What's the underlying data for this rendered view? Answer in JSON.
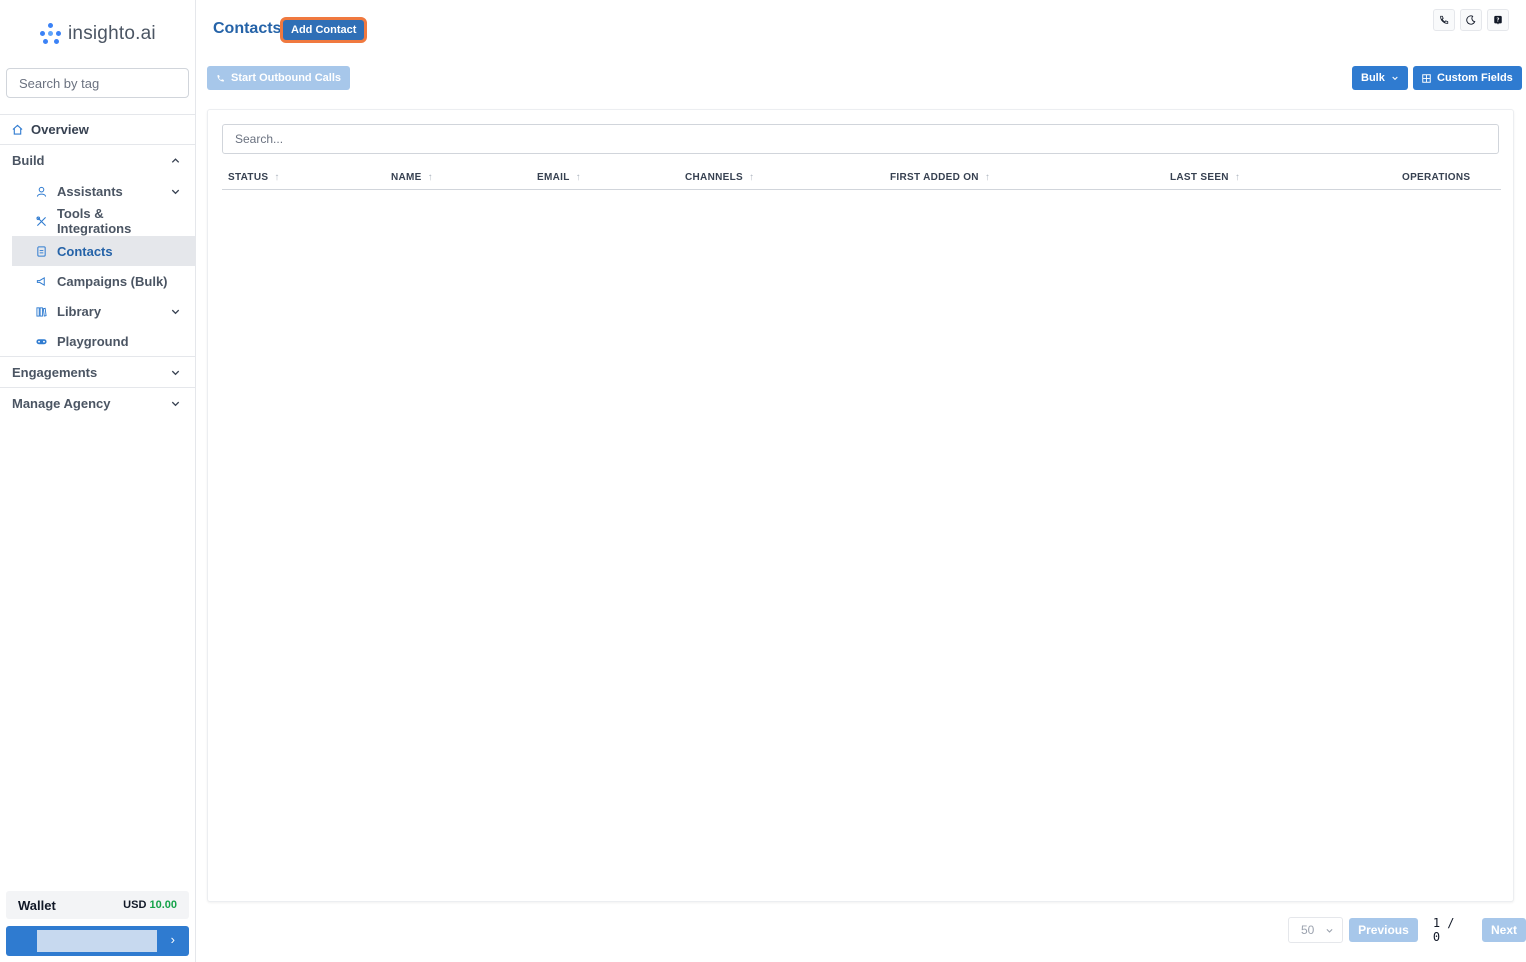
{
  "brand": {
    "name": "insighto.ai"
  },
  "sidebar": {
    "search_placeholder": "Search by tag",
    "overview": "Overview",
    "sections": {
      "build": "Build",
      "engagements": "Engagements",
      "manage_agency": "Manage Agency"
    },
    "build_items": {
      "assistants": "Assistants",
      "tools": "Tools & Integrations",
      "contacts": "Contacts",
      "campaigns": "Campaigns (Bulk)",
      "library": "Library",
      "playground": "Playground"
    },
    "wallet": {
      "label": "Wallet",
      "currency": "USD",
      "amount": "10.00"
    }
  },
  "header": {
    "title": "Contacts",
    "add_button": "Add Contact"
  },
  "toolbar": {
    "outbound_label": "Start Outbound Calls",
    "bulk_label": "Bulk",
    "custom_fields_label": "Custom Fields"
  },
  "table": {
    "search_placeholder": "Search...",
    "columns": [
      "STATUS",
      "NAME",
      "EMAIL",
      "CHANNELS",
      "FIRST ADDED ON",
      "LAST SEEN",
      "OPERATIONS"
    ],
    "rows": []
  },
  "pagination": {
    "page_size": "50",
    "previous": "Previous",
    "info": "1 / 0",
    "next": "Next"
  },
  "colors": {
    "primary": "#2f7bd0",
    "primary_disabled": "#a7c7ea",
    "highlight": "#f0793f",
    "wallet_amount": "#16a34a"
  }
}
